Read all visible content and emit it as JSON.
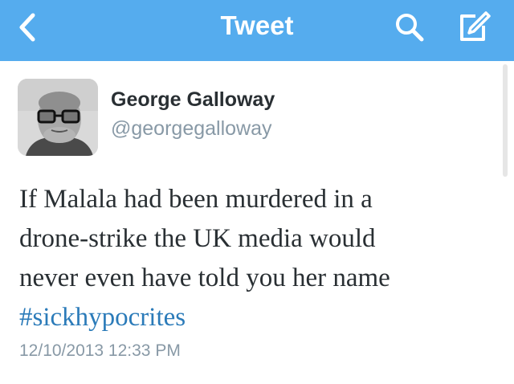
{
  "navbar": {
    "title": "Tweet",
    "back_icon": "chevron-left-icon",
    "search_icon": "search-icon",
    "compose_icon": "compose-icon",
    "background_color": "#55acee"
  },
  "tweet": {
    "author_name": "George Galloway",
    "author_handle": "@georgegalloway",
    "text_lines": [
      "If Malala had been murdered in a",
      "drone-strike the UK media would",
      "never even have told you her name"
    ],
    "hashtag": "#sickhypocrites",
    "hashtag_color": "#2b7bb9",
    "timestamp": "12/10/2013 12:33 PM"
  }
}
